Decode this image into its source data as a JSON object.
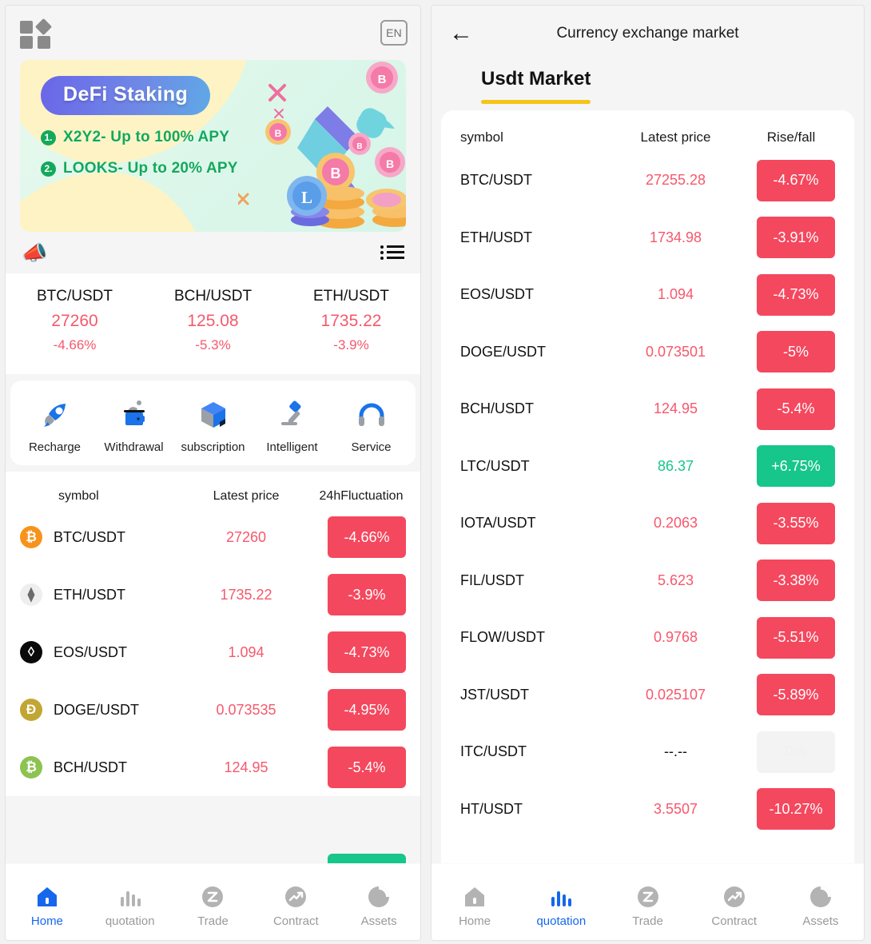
{
  "left": {
    "topbar": {
      "grid_icon": "grid-icon",
      "language": "EN"
    },
    "banner": {
      "title": "DeFi Staking",
      "line1_num": "1.",
      "line1": "X2Y2- Up to 100% APY",
      "line2_num": "2.",
      "line2": "LOOKS- Up to 20% APY"
    },
    "notice": {
      "megaphone_icon": "megaphone-icon",
      "text": "",
      "list_icon": "list-icon"
    },
    "tickers": [
      {
        "symbol": "BTC/USDT",
        "price": "27260",
        "change": "-4.66%"
      },
      {
        "symbol": "BCH/USDT",
        "price": "125.08",
        "change": "-5.3%"
      },
      {
        "symbol": "ETH/USDT",
        "price": "1735.22",
        "change": "-3.9%"
      }
    ],
    "quick_actions": [
      {
        "label": "Recharge",
        "icon": "rocket-icon"
      },
      {
        "label": "Withdrawal",
        "icon": "wallet-icon"
      },
      {
        "label": "subscription",
        "icon": "cube-icon"
      },
      {
        "label": "Intelligent",
        "icon": "gavel-icon"
      },
      {
        "label": "Service",
        "icon": "headset-icon"
      }
    ],
    "market": {
      "headers": {
        "symbol": "symbol",
        "price": "Latest price",
        "change": "24hFluctuation"
      },
      "rows": [
        {
          "symbol": "BTC/USDT",
          "price": "27260",
          "change": "-4.66%",
          "dir": "down",
          "coin": "₿",
          "coin_bg": "#F7931A",
          "coin_fg": "#ffffff"
        },
        {
          "symbol": "ETH/USDT",
          "price": "1735.22",
          "change": "-3.9%",
          "dir": "down",
          "coin": "⧫",
          "coin_bg": "#EEEEEE",
          "coin_fg": "#6b6b6b"
        },
        {
          "symbol": "EOS/USDT",
          "price": "1.094",
          "change": "-4.73%",
          "dir": "down",
          "coin": "◊",
          "coin_bg": "#0A0A0A",
          "coin_fg": "#ffffff"
        },
        {
          "symbol": "DOGE/USDT",
          "price": "0.073535",
          "change": "-4.95%",
          "dir": "down",
          "coin": "Đ",
          "coin_bg": "#C2A633",
          "coin_fg": "#ffffff"
        },
        {
          "symbol": "BCH/USDT",
          "price": "124.95",
          "change": "-5.4%",
          "dir": "down",
          "coin": "₿",
          "coin_bg": "#8DC351",
          "coin_fg": "#ffffff"
        }
      ]
    },
    "tabbar": {
      "active": "Home",
      "items": [
        {
          "label": "Home",
          "icon": "home-icon"
        },
        {
          "label": "quotation",
          "icon": "bars-icon"
        },
        {
          "label": "Trade",
          "icon": "trade-icon"
        },
        {
          "label": "Contract",
          "icon": "contract-icon"
        },
        {
          "label": "Assets",
          "icon": "assets-icon"
        }
      ]
    }
  },
  "right": {
    "header": {
      "back_icon": "back-arrow-icon",
      "title": "Currency exchange market"
    },
    "tab": {
      "label": "Usdt Market",
      "active": true
    },
    "headers": {
      "symbol": "symbol",
      "price": "Latest price",
      "change": "Rise/fall"
    },
    "rows": [
      {
        "symbol": "BTC/USDT",
        "price": "27255.28",
        "change": "-4.67%",
        "dir": "down"
      },
      {
        "symbol": "ETH/USDT",
        "price": "1734.98",
        "change": "-3.91%",
        "dir": "down"
      },
      {
        "symbol": "EOS/USDT",
        "price": "1.094",
        "change": "-4.73%",
        "dir": "down"
      },
      {
        "symbol": "DOGE/USDT",
        "price": "0.073501",
        "change": "-5%",
        "dir": "down"
      },
      {
        "symbol": "BCH/USDT",
        "price": "124.95",
        "change": "-5.4%",
        "dir": "down"
      },
      {
        "symbol": "LTC/USDT",
        "price": "86.37",
        "change": "+6.75%",
        "dir": "up"
      },
      {
        "symbol": "IOTA/USDT",
        "price": "0.2063",
        "change": "-3.55%",
        "dir": "down"
      },
      {
        "symbol": "FIL/USDT",
        "price": "5.623",
        "change": "-3.38%",
        "dir": "down"
      },
      {
        "symbol": "FLOW/USDT",
        "price": "0.9768",
        "change": "-5.51%",
        "dir": "down"
      },
      {
        "symbol": "JST/USDT",
        "price": "0.025107",
        "change": "-5.89%",
        "dir": "down"
      },
      {
        "symbol": "ITC/USDT",
        "price": "--.--",
        "change": "0%",
        "dir": "flat"
      },
      {
        "symbol": "HT/USDT",
        "price": "3.5507",
        "change": "-10.27%",
        "dir": "down"
      }
    ],
    "tabbar": {
      "active": "quotation",
      "items": [
        {
          "label": "Home",
          "icon": "home-icon"
        },
        {
          "label": "quotation",
          "icon": "bars-icon"
        },
        {
          "label": "Trade",
          "icon": "trade-icon"
        },
        {
          "label": "Contract",
          "icon": "contract-icon"
        },
        {
          "label": "Assets",
          "icon": "assets-icon"
        }
      ]
    }
  },
  "colors": {
    "down_red": "#F4485E",
    "up_green": "#17C68A",
    "price_red": "#F6586C",
    "accent_blue": "#1667EC",
    "tab_underline": "#F5C518"
  }
}
